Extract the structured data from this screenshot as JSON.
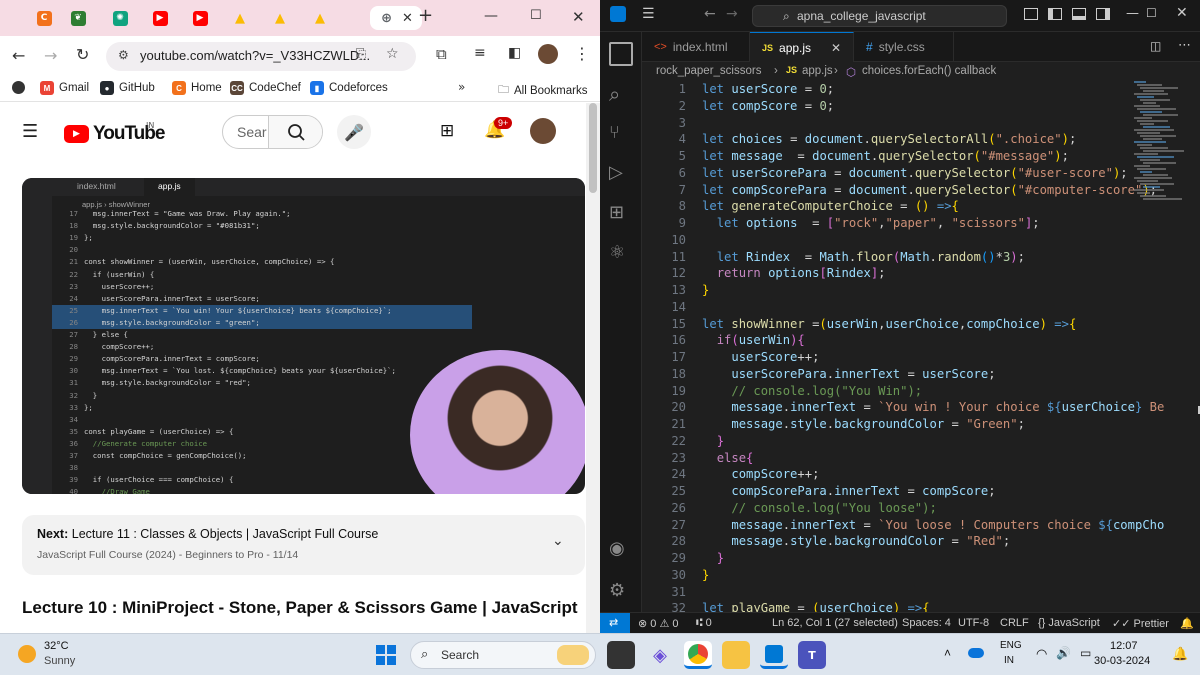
{
  "chrome": {
    "tabs": [
      {
        "icon": "codechef-icon",
        "color": "#f2711c",
        "glyph": "C"
      },
      {
        "icon": "leaf-icon",
        "color": "#2e7d32",
        "glyph": "❦"
      },
      {
        "icon": "chatgpt-icon",
        "color": "#10a37f",
        "glyph": "✺"
      },
      {
        "icon": "youtube-icon",
        "color": "#ff0000",
        "glyph": "▶"
      },
      {
        "icon": "youtube-icon",
        "color": "#ff0000",
        "glyph": "▶"
      },
      {
        "icon": "drive-icon",
        "color": "#fbbc04",
        "glyph": "▲"
      },
      {
        "icon": "drive-icon",
        "color": "#fbbc04",
        "glyph": "▲"
      },
      {
        "icon": "drive-icon",
        "color": "#fbbc04",
        "glyph": "▲"
      },
      {
        "icon": "globe-icon",
        "color": "#5f6368",
        "glyph": "⊕"
      }
    ],
    "url": "youtube.com/watch?v=_V33HCZWLD...",
    "bookmarks": [
      {
        "label": "Gmail",
        "glyph": "M",
        "color": "#ea4335"
      },
      {
        "label": "GitHub",
        "glyph": "●",
        "color": "#24292f"
      },
      {
        "label": "Home",
        "glyph": "C",
        "color": "#f2711c"
      },
      {
        "label": "CodeChef",
        "glyph": "CC",
        "color": "#5b4638"
      },
      {
        "label": "Codeforces",
        "glyph": "▮",
        "color": "#1a73e8"
      }
    ],
    "all_bookmarks": "All Bookmarks"
  },
  "youtube": {
    "logo_text": "YouTube",
    "country": "IN",
    "search_placeholder": "Sear",
    "notif_count": "9+",
    "next_label": "Next:",
    "next_title": "Lecture 11 : Classes & Objects | JavaScript Full Course",
    "next_playlist": "JavaScript Full Course (2024) - Beginners to Pro - 11/14",
    "video_title": "Lecture 10 : MiniProject - Stone, Paper & Scissors Game | JavaScript",
    "video": {
      "tabs": [
        "index.html",
        "app.js"
      ],
      "breadcrumb": "app.js",
      "breadcrumb_fn": "showWinner",
      "lines": [
        {
          "n": "17",
          "t": "  msg.innerText = \"Game was Draw. Play again.\";"
        },
        {
          "n": "18",
          "t": "  msg.style.backgroundColor = \"#081b31\";"
        },
        {
          "n": "19",
          "t": "};"
        },
        {
          "n": "20",
          "t": ""
        },
        {
          "n": "21",
          "t": "const showWinner = (userWin, userChoice, compChoice) => {"
        },
        {
          "n": "22",
          "t": "  if (userWin) {"
        },
        {
          "n": "23",
          "t": "    userScore++;"
        },
        {
          "n": "24",
          "t": "    userScorePara.innerText = userScore;"
        },
        {
          "n": "25",
          "t": "    msg.innerText = `You win! Your ${userChoice} beats ${compChoice}`;"
        },
        {
          "n": "26",
          "t": "    msg.style.backgroundColor = \"green\";"
        },
        {
          "n": "27",
          "t": "  } else {"
        },
        {
          "n": "28",
          "t": "    compScore++;"
        },
        {
          "n": "29",
          "t": "    compScorePara.innerText = compScore;"
        },
        {
          "n": "30",
          "t": "    msg.innerText = `You lost. ${compChoice} beats your ${userChoice}`;"
        },
        {
          "n": "31",
          "t": "    msg.style.backgroundColor = \"red\";"
        },
        {
          "n": "32",
          "t": "  }"
        },
        {
          "n": "33",
          "t": "};"
        },
        {
          "n": "34",
          "t": ""
        },
        {
          "n": "35",
          "t": "const playGame = (userChoice) => {"
        },
        {
          "n": "36",
          "t": "  //Generate computer choice"
        },
        {
          "n": "37",
          "t": "  const compChoice = genCompChoice();"
        },
        {
          "n": "38",
          "t": ""
        },
        {
          "n": "39",
          "t": "  if (userChoice === compChoice) {"
        },
        {
          "n": "40",
          "t": "    //Draw Game"
        }
      ]
    }
  },
  "vscode": {
    "search": "apna_college_javascript",
    "tabs": [
      "index.html",
      "app.js",
      "style.css"
    ],
    "breadcrumb": [
      "rock_paper_scissors",
      "app.js",
      "choices.forEach() callback"
    ],
    "status": {
      "errors": "0",
      "warnings": "0",
      "ports": "0",
      "position": "Ln 62, Col 1 (27 selected)",
      "spaces": "Spaces: 4",
      "encoding": "UTF-8",
      "eol": "CRLF",
      "language": "JavaScript",
      "formatter": "Prettier"
    },
    "code": [
      {
        "n": "1",
        "h": "<span class='k'>let</span> <span class='v'>userScore</span> <span class='o'>=</span> <span class='num'>0</span><span class='o'>;</span>"
      },
      {
        "n": "2",
        "h": "<span class='k'>let</span> <span class='v'>compScore</span> <span class='o'>=</span> <span class='num'>0</span><span class='o'>;</span>"
      },
      {
        "n": "3",
        "h": ""
      },
      {
        "n": "4",
        "h": "<span class='k'>let</span> <span class='v'>choices</span> <span class='o'>=</span> <span class='v'>document</span><span class='o'>.</span><span class='f'>querySelectorAll</span><span class='b1'>(</span><span class='s'>\".choice\"</span><span class='b1'>)</span><span class='o'>;</span>"
      },
      {
        "n": "5",
        "h": "<span class='k'>let</span> <span class='v'>message</span>  <span class='o'>=</span> <span class='v'>document</span><span class='o'>.</span><span class='f'>querySelector</span><span class='b1'>(</span><span class='s'>\"#message\"</span><span class='b1'>)</span><span class='o'>;</span>"
      },
      {
        "n": "6",
        "h": "<span class='k'>let</span> <span class='v'>userScorePara</span> <span class='o'>=</span> <span class='v'>document</span><span class='o'>.</span><span class='f'>querySelector</span><span class='b1'>(</span><span class='s'>\"#user-score\"</span><span class='b1'>)</span><span class='o'>;</span>"
      },
      {
        "n": "7",
        "h": "<span class='k'>let</span> <span class='v'>compScorePara</span> <span class='o'>=</span> <span class='v'>document</span><span class='o'>.</span><span class='f'>querySelector</span><span class='b1'>(</span><span class='s'>\"#computer-score\"</span><span class='b1'>)</span><span class='o'>;</span>"
      },
      {
        "n": "8",
        "h": "<span class='k'>let</span> <span class='f'>generateComputerChoice</span> <span class='o'>=</span> <span class='b1'>()</span> <span class='k'>=&gt;</span><span class='b1'>{</span>"
      },
      {
        "n": "9",
        "h": "  <span class='k'>let</span> <span class='v'>options</span>  <span class='o'>=</span> <span class='b2'>[</span><span class='s'>\"rock\"</span><span class='o'>,</span><span class='s'>\"paper\"</span><span class='o'>,</span> <span class='s'>\"scissors\"</span><span class='b2'>]</span><span class='o'>;</span>"
      },
      {
        "n": "10",
        "h": ""
      },
      {
        "n": "11",
        "h": "  <span class='k'>let</span> <span class='v'>Rindex</span>  <span class='o'>=</span> <span class='v'>Math</span><span class='o'>.</span><span class='f'>floor</span><span class='b2'>(</span><span class='v'>Math</span><span class='o'>.</span><span class='f'>random</span><span class='b3'>()</span><span class='o'>*</span><span class='num'>3</span><span class='b2'>)</span><span class='o'>;</span>"
      },
      {
        "n": "12",
        "h": "  <span class='kw'>return</span> <span class='v'>options</span><span class='b2'>[</span><span class='v'>Rindex</span><span class='b2'>]</span><span class='o'>;</span>"
      },
      {
        "n": "13",
        "h": "<span class='b1'>}</span>"
      },
      {
        "n": "14",
        "h": ""
      },
      {
        "n": "15",
        "h": "<span class='k'>let</span> <span class='f'>showWinner</span> <span class='o'>=</span><span class='b1'>(</span><span class='v'>userWin</span><span class='o'>,</span><span class='v'>userChoice</span><span class='o'>,</span><span class='v'>compChoice</span><span class='b1'>)</span> <span class='k'>=&gt;</span><span class='b1'>{</span>"
      },
      {
        "n": "16",
        "h": "  <span class='kw'>if</span><span class='b2'>(</span><span class='v'>userWin</span><span class='b2'>){</span>"
      },
      {
        "n": "17",
        "h": "    <span class='v'>userScore</span><span class='o'>++;</span>"
      },
      {
        "n": "18",
        "h": "    <span class='v'>userScorePara</span><span class='o'>.</span><span class='v'>innerText</span> <span class='o'>=</span> <span class='v'>userScore</span><span class='o'>;</span>"
      },
      {
        "n": "19",
        "h": "    <span class='c'>// console.log(\"You Win\");</span>"
      },
      {
        "n": "20",
        "h": "    <span class='v'>message</span><span class='o'>.</span><span class='v'>innerText</span> <span class='o'>=</span> <span class='s'>`You win ! Your choice </span><span class='k'>${</span><span class='v'>userChoice</span><span class='k'>}</span><span class='s'> Be</span>"
      },
      {
        "n": "21",
        "h": "    <span class='v'>message</span><span class='o'>.</span><span class='v'>style</span><span class='o'>.</span><span class='v'>backgroundColor</span> <span class='o'>=</span> <span class='s'>\"Green\"</span><span class='o'>;</span>"
      },
      {
        "n": "22",
        "h": "  <span class='b2'>}</span>"
      },
      {
        "n": "23",
        "h": "  <span class='kw'>else</span><span class='b2'>{</span>"
      },
      {
        "n": "24",
        "h": "    <span class='v'>compScore</span><span class='o'>++;</span>"
      },
      {
        "n": "25",
        "h": "    <span class='v'>compScorePara</span><span class='o'>.</span><span class='v'>innerText</span> <span class='o'>=</span> <span class='v'>compScore</span><span class='o'>;</span>"
      },
      {
        "n": "26",
        "h": "    <span class='c'>// console.log(\"You loose\");</span>"
      },
      {
        "n": "27",
        "h": "    <span class='v'>message</span><span class='o'>.</span><span class='v'>innerText</span> <span class='o'>=</span> <span class='s'>`You loose ! Computers choice </span><span class='k'>${</span><span class='v'>compCho</span>"
      },
      {
        "n": "28",
        "h": "    <span class='v'>message</span><span class='o'>.</span><span class='v'>style</span><span class='o'>.</span><span class='v'>backgroundColor</span> <span class='o'>=</span> <span class='s'>\"Red\"</span><span class='o'>;</span>"
      },
      {
        "n": "29",
        "h": "  <span class='b2'>}</span>"
      },
      {
        "n": "30",
        "h": "<span class='b1'>}</span>"
      },
      {
        "n": "31",
        "h": ""
      },
      {
        "n": "32",
        "h": "<span class='k'>let</span> <span class='f'>playGame</span> <span class='o'>=</span> <span class='b1'>(</span><span class='v'>userChoice</span><span class='b1'>)</span> <span class='k'>=&gt;</span><span class='b1'>{</span>"
      }
    ]
  },
  "taskbar": {
    "temp": "32°C",
    "weather": "Sunny",
    "search": "Search",
    "lang1": "ENG",
    "lang2": "IN",
    "time": "12:07",
    "date": "30-03-2024"
  },
  "colors": {
    "accent": "#0078d4",
    "yt_red": "#ff0000",
    "vs_bg": "#1f1f1f"
  }
}
